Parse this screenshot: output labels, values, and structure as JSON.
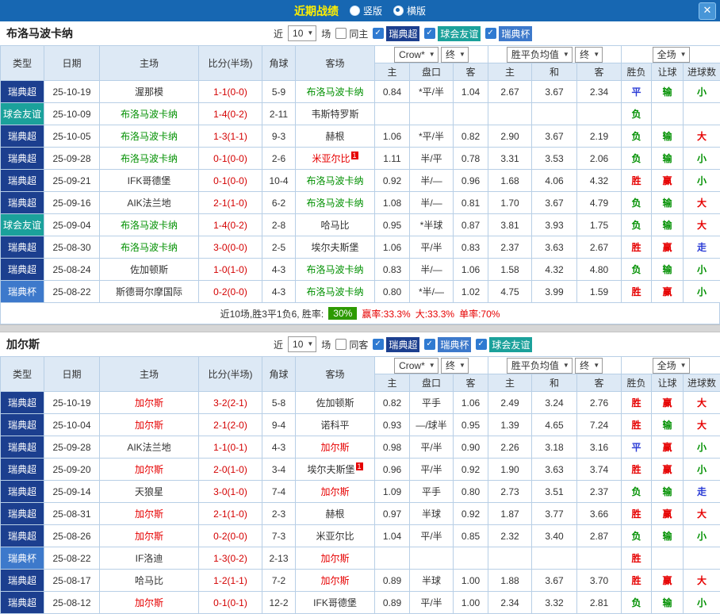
{
  "header": {
    "title": "近期战绩",
    "modes": [
      {
        "label": "竖版",
        "selected": false
      },
      {
        "label": "横版",
        "selected": true
      }
    ],
    "close": "✕",
    "bar_color": "#1767b2"
  },
  "filter_template": {
    "near": "近",
    "matches_value": "10",
    "games": "场",
    "bookmaker_dd": "Crow*",
    "final_dd1": "终",
    "avg_dd": "胜平负均值",
    "final_dd2": "终",
    "scope_dd": "全场"
  },
  "table_headers": {
    "left": [
      "类型",
      "日期",
      "主场",
      "比分(半场)",
      "角球",
      "客场"
    ],
    "handicap": [
      "主",
      "盘口",
      "客"
    ],
    "europe": [
      "主",
      "和",
      "客"
    ],
    "result": [
      "胜负",
      "让球",
      "进球数"
    ]
  },
  "league_colors": {
    "瑞典超": "#1c3f8f",
    "球会友谊": "#1ba19b",
    "瑞典杯": "#3d79cb"
  },
  "sections": [
    {
      "team": "布洛马波卡纳",
      "same_label": "同主",
      "same_checked": false,
      "leagues": [
        {
          "label": "瑞典超",
          "checked": true
        },
        {
          "label": "球会友谊",
          "checked": true
        },
        {
          "label": "瑞典杯",
          "checked": true
        }
      ],
      "rows": [
        {
          "league": "瑞典超",
          "date": "25-10-19",
          "home": "渥那模",
          "home_cls": "black",
          "score": "1-1(0-0)",
          "corners": "5-9",
          "away": "布洛马波卡纳",
          "away_cls": "green",
          "h": [
            "0.84",
            "*平/半",
            "1.04"
          ],
          "e": [
            "2.67",
            "3.67",
            "2.34"
          ],
          "res": [
            [
              "平",
              "blue"
            ],
            [
              "输",
              "green"
            ],
            [
              "小",
              "green"
            ]
          ]
        },
        {
          "league": "球会友谊",
          "date": "25-10-09",
          "home": "布洛马波卡纳",
          "home_cls": "green",
          "score": "1-4(0-2)",
          "corners": "2-11",
          "away": "韦斯特罗斯",
          "away_cls": "black",
          "h": [
            "",
            "",
            ""
          ],
          "e": [
            "",
            "",
            ""
          ],
          "res": [
            [
              "负",
              "green"
            ],
            [
              "",
              ""
            ],
            [
              "",
              ""
            ]
          ]
        },
        {
          "league": "瑞典超",
          "date": "25-10-05",
          "home": "布洛马波卡纳",
          "home_cls": "green",
          "score": "1-3(1-1)",
          "corners": "9-3",
          "away": "赫根",
          "away_cls": "black",
          "h": [
            "1.06",
            "*平/半",
            "0.82"
          ],
          "e": [
            "2.90",
            "3.67",
            "2.19"
          ],
          "res": [
            [
              "负",
              "green"
            ],
            [
              "输",
              "green"
            ],
            [
              "大",
              "red"
            ]
          ]
        },
        {
          "league": "瑞典超",
          "date": "25-09-28",
          "home": "布洛马波卡纳",
          "home_cls": "green",
          "score": "0-1(0-0)",
          "corners": "2-6",
          "away": "米亚尔比",
          "away_cls": "red",
          "away_sup": "1",
          "h": [
            "1.11",
            "半/平",
            "0.78"
          ],
          "e": [
            "3.31",
            "3.53",
            "2.06"
          ],
          "res": [
            [
              "负",
              "green"
            ],
            [
              "输",
              "green"
            ],
            [
              "小",
              "green"
            ]
          ]
        },
        {
          "league": "瑞典超",
          "date": "25-09-21",
          "home": "IFK哥德堡",
          "home_cls": "black",
          "score": "0-1(0-0)",
          "corners": "10-4",
          "away": "布洛马波卡纳",
          "away_cls": "green",
          "h": [
            "0.92",
            "半/—",
            "0.96"
          ],
          "e": [
            "1.68",
            "4.06",
            "4.32"
          ],
          "res": [
            [
              "胜",
              "red"
            ],
            [
              "赢",
              "red"
            ],
            [
              "小",
              "green"
            ]
          ]
        },
        {
          "league": "瑞典超",
          "date": "25-09-16",
          "home": "AIK法兰地",
          "home_cls": "black",
          "score": "2-1(1-0)",
          "corners": "6-2",
          "away": "布洛马波卡纳",
          "away_cls": "green",
          "h": [
            "1.08",
            "半/—",
            "0.81"
          ],
          "e": [
            "1.70",
            "3.67",
            "4.79"
          ],
          "res": [
            [
              "负",
              "green"
            ],
            [
              "输",
              "green"
            ],
            [
              "大",
              "red"
            ]
          ]
        },
        {
          "league": "球会友谊",
          "date": "25-09-04",
          "home": "布洛马波卡纳",
          "home_cls": "green",
          "score": "1-4(0-2)",
          "corners": "2-8",
          "away": "哈马比",
          "away_cls": "black",
          "h": [
            "0.95",
            "*半球",
            "0.87"
          ],
          "e": [
            "3.81",
            "3.93",
            "1.75"
          ],
          "res": [
            [
              "负",
              "green"
            ],
            [
              "输",
              "green"
            ],
            [
              "大",
              "red"
            ]
          ]
        },
        {
          "league": "瑞典超",
          "date": "25-08-30",
          "home": "布洛马波卡纳",
          "home_cls": "green",
          "score": "3-0(0-0)",
          "corners": "2-5",
          "away": "埃尔夫斯堡",
          "away_cls": "black",
          "h": [
            "1.06",
            "平/半",
            "0.83"
          ],
          "e": [
            "2.37",
            "3.63",
            "2.67"
          ],
          "res": [
            [
              "胜",
              "red"
            ],
            [
              "赢",
              "red"
            ],
            [
              "走",
              "blue"
            ]
          ]
        },
        {
          "league": "瑞典超",
          "date": "25-08-24",
          "home": "佐加顿斯",
          "home_cls": "black",
          "score": "1-0(1-0)",
          "corners": "4-3",
          "away": "布洛马波卡纳",
          "away_cls": "green",
          "h": [
            "0.83",
            "半/—",
            "1.06"
          ],
          "e": [
            "1.58",
            "4.32",
            "4.80"
          ],
          "res": [
            [
              "负",
              "green"
            ],
            [
              "输",
              "green"
            ],
            [
              "小",
              "green"
            ]
          ]
        },
        {
          "league": "瑞典杯",
          "date": "25-08-22",
          "home": "斯德哥尔摩国际",
          "home_cls": "black",
          "score": "0-2(0-0)",
          "corners": "4-3",
          "away": "布洛马波卡纳",
          "away_cls": "green",
          "h": [
            "0.80",
            "*半/—",
            "1.02"
          ],
          "e": [
            "4.75",
            "3.99",
            "1.59"
          ],
          "res": [
            [
              "胜",
              "red"
            ],
            [
              "赢",
              "red"
            ],
            [
              "小",
              "green"
            ]
          ]
        }
      ],
      "summary": {
        "prefix": "近10场,胜3平1负6, 胜率:",
        "rate": "30%",
        "stats": [
          "赢率:33.3%",
          "大:33.3%",
          "单率:70%"
        ]
      }
    },
    {
      "team": "加尔斯",
      "same_label": "同客",
      "same_checked": false,
      "leagues": [
        {
          "label": "瑞典超",
          "checked": true
        },
        {
          "label": "瑞典杯",
          "checked": true
        },
        {
          "label": "球会友谊",
          "checked": true
        }
      ],
      "rows": [
        {
          "league": "瑞典超",
          "date": "25-10-19",
          "home": "加尔斯",
          "home_cls": "red",
          "score": "3-2(2-1)",
          "corners": "5-8",
          "away": "佐加顿斯",
          "away_cls": "black",
          "h": [
            "0.82",
            "平手",
            "1.06"
          ],
          "e": [
            "2.49",
            "3.24",
            "2.76"
          ],
          "res": [
            [
              "胜",
              "red"
            ],
            [
              "赢",
              "red"
            ],
            [
              "大",
              "red"
            ]
          ]
        },
        {
          "league": "瑞典超",
          "date": "25-10-04",
          "home": "加尔斯",
          "home_cls": "red",
          "score": "2-1(2-0)",
          "corners": "9-4",
          "away": "诺科平",
          "away_cls": "black",
          "h": [
            "0.93",
            "—/球半",
            "0.95"
          ],
          "e": [
            "1.39",
            "4.65",
            "7.24"
          ],
          "res": [
            [
              "胜",
              "red"
            ],
            [
              "输",
              "green"
            ],
            [
              "大",
              "red"
            ]
          ]
        },
        {
          "league": "瑞典超",
          "date": "25-09-28",
          "home": "AIK法兰地",
          "home_cls": "black",
          "score": "1-1(0-1)",
          "corners": "4-3",
          "away": "加尔斯",
          "away_cls": "red",
          "h": [
            "0.98",
            "平/半",
            "0.90"
          ],
          "e": [
            "2.26",
            "3.18",
            "3.16"
          ],
          "res": [
            [
              "平",
              "blue"
            ],
            [
              "赢",
              "red"
            ],
            [
              "小",
              "green"
            ]
          ]
        },
        {
          "league": "瑞典超",
          "date": "25-09-20",
          "home": "加尔斯",
          "home_cls": "red",
          "score": "2-0(1-0)",
          "corners": "3-4",
          "away": "埃尔夫斯堡",
          "away_cls": "black",
          "away_sup": "1",
          "h": [
            "0.96",
            "平/半",
            "0.92"
          ],
          "e": [
            "1.90",
            "3.63",
            "3.74"
          ],
          "res": [
            [
              "胜",
              "red"
            ],
            [
              "赢",
              "red"
            ],
            [
              "小",
              "green"
            ]
          ]
        },
        {
          "league": "瑞典超",
          "date": "25-09-14",
          "home": "天狼星",
          "home_cls": "black",
          "score": "3-0(1-0)",
          "corners": "7-4",
          "away": "加尔斯",
          "away_cls": "red",
          "h": [
            "1.09",
            "平手",
            "0.80"
          ],
          "e": [
            "2.73",
            "3.51",
            "2.37"
          ],
          "res": [
            [
              "负",
              "green"
            ],
            [
              "输",
              "green"
            ],
            [
              "走",
              "blue"
            ]
          ]
        },
        {
          "league": "瑞典超",
          "date": "25-08-31",
          "home": "加尔斯",
          "home_cls": "red",
          "score": "2-1(1-0)",
          "corners": "2-3",
          "away": "赫根",
          "away_cls": "black",
          "h": [
            "0.97",
            "半球",
            "0.92"
          ],
          "e": [
            "1.87",
            "3.77",
            "3.66"
          ],
          "res": [
            [
              "胜",
              "red"
            ],
            [
              "赢",
              "red"
            ],
            [
              "大",
              "red"
            ]
          ]
        },
        {
          "league": "瑞典超",
          "date": "25-08-26",
          "home": "加尔斯",
          "home_cls": "red",
          "score": "0-2(0-0)",
          "corners": "7-3",
          "away": "米亚尔比",
          "away_cls": "black",
          "h": [
            "1.04",
            "平/半",
            "0.85"
          ],
          "e": [
            "2.32",
            "3.40",
            "2.87"
          ],
          "res": [
            [
              "负",
              "green"
            ],
            [
              "输",
              "green"
            ],
            [
              "小",
              "green"
            ]
          ]
        },
        {
          "league": "瑞典杯",
          "date": "25-08-22",
          "home": "IF洛迪",
          "home_cls": "black",
          "score": "1-3(0-2)",
          "corners": "2-13",
          "away": "加尔斯",
          "away_cls": "red",
          "h": [
            "",
            "",
            ""
          ],
          "e": [
            "",
            "",
            ""
          ],
          "res": [
            [
              "胜",
              "red"
            ],
            [
              "",
              ""
            ],
            [
              "",
              ""
            ]
          ]
        },
        {
          "league": "瑞典超",
          "date": "25-08-17",
          "home": "哈马比",
          "home_cls": "black",
          "score": "1-2(1-1)",
          "corners": "7-2",
          "away": "加尔斯",
          "away_cls": "red",
          "h": [
            "0.89",
            "半球",
            "1.00"
          ],
          "e": [
            "1.88",
            "3.67",
            "3.70"
          ],
          "res": [
            [
              "胜",
              "red"
            ],
            [
              "赢",
              "red"
            ],
            [
              "大",
              "red"
            ]
          ]
        },
        {
          "league": "瑞典超",
          "date": "25-08-12",
          "home": "加尔斯",
          "home_cls": "red",
          "score": "0-1(0-1)",
          "corners": "12-2",
          "away": "IFK哥德堡",
          "away_cls": "black",
          "h": [
            "0.89",
            "平/半",
            "1.00"
          ],
          "e": [
            "2.34",
            "3.32",
            "2.81"
          ],
          "res": [
            [
              "负",
              "green"
            ],
            [
              "输",
              "green"
            ],
            [
              "小",
              "green"
            ]
          ]
        }
      ]
    }
  ]
}
